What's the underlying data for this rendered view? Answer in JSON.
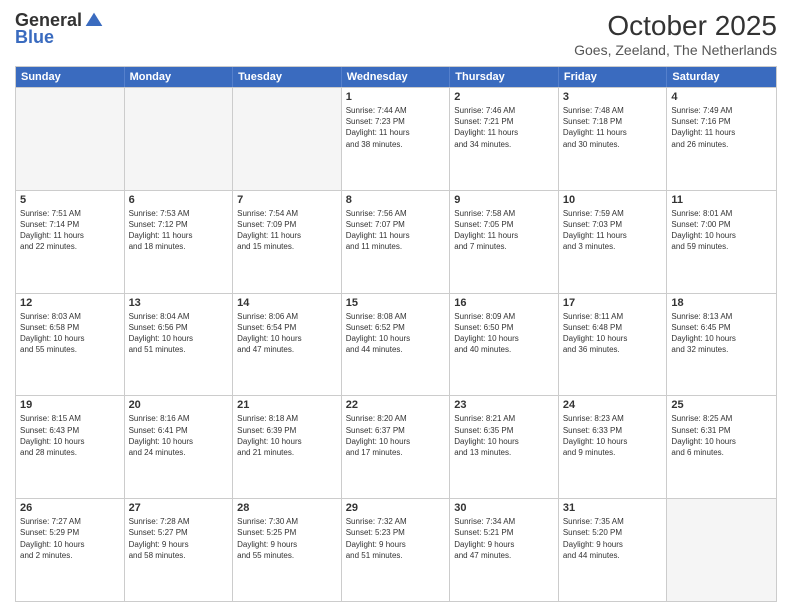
{
  "logo": {
    "general": "General",
    "blue": "Blue"
  },
  "header": {
    "month": "October 2025",
    "location": "Goes, Zeeland, The Netherlands"
  },
  "weekdays": [
    "Sunday",
    "Monday",
    "Tuesday",
    "Wednesday",
    "Thursday",
    "Friday",
    "Saturday"
  ],
  "rows": [
    [
      {
        "day": "",
        "lines": []
      },
      {
        "day": "",
        "lines": []
      },
      {
        "day": "",
        "lines": []
      },
      {
        "day": "1",
        "lines": [
          "Sunrise: 7:44 AM",
          "Sunset: 7:23 PM",
          "Daylight: 11 hours",
          "and 38 minutes."
        ]
      },
      {
        "day": "2",
        "lines": [
          "Sunrise: 7:46 AM",
          "Sunset: 7:21 PM",
          "Daylight: 11 hours",
          "and 34 minutes."
        ]
      },
      {
        "day": "3",
        "lines": [
          "Sunrise: 7:48 AM",
          "Sunset: 7:18 PM",
          "Daylight: 11 hours",
          "and 30 minutes."
        ]
      },
      {
        "day": "4",
        "lines": [
          "Sunrise: 7:49 AM",
          "Sunset: 7:16 PM",
          "Daylight: 11 hours",
          "and 26 minutes."
        ]
      }
    ],
    [
      {
        "day": "5",
        "lines": [
          "Sunrise: 7:51 AM",
          "Sunset: 7:14 PM",
          "Daylight: 11 hours",
          "and 22 minutes."
        ]
      },
      {
        "day": "6",
        "lines": [
          "Sunrise: 7:53 AM",
          "Sunset: 7:12 PM",
          "Daylight: 11 hours",
          "and 18 minutes."
        ]
      },
      {
        "day": "7",
        "lines": [
          "Sunrise: 7:54 AM",
          "Sunset: 7:09 PM",
          "Daylight: 11 hours",
          "and 15 minutes."
        ]
      },
      {
        "day": "8",
        "lines": [
          "Sunrise: 7:56 AM",
          "Sunset: 7:07 PM",
          "Daylight: 11 hours",
          "and 11 minutes."
        ]
      },
      {
        "day": "9",
        "lines": [
          "Sunrise: 7:58 AM",
          "Sunset: 7:05 PM",
          "Daylight: 11 hours",
          "and 7 minutes."
        ]
      },
      {
        "day": "10",
        "lines": [
          "Sunrise: 7:59 AM",
          "Sunset: 7:03 PM",
          "Daylight: 11 hours",
          "and 3 minutes."
        ]
      },
      {
        "day": "11",
        "lines": [
          "Sunrise: 8:01 AM",
          "Sunset: 7:00 PM",
          "Daylight: 10 hours",
          "and 59 minutes."
        ]
      }
    ],
    [
      {
        "day": "12",
        "lines": [
          "Sunrise: 8:03 AM",
          "Sunset: 6:58 PM",
          "Daylight: 10 hours",
          "and 55 minutes."
        ]
      },
      {
        "day": "13",
        "lines": [
          "Sunrise: 8:04 AM",
          "Sunset: 6:56 PM",
          "Daylight: 10 hours",
          "and 51 minutes."
        ]
      },
      {
        "day": "14",
        "lines": [
          "Sunrise: 8:06 AM",
          "Sunset: 6:54 PM",
          "Daylight: 10 hours",
          "and 47 minutes."
        ]
      },
      {
        "day": "15",
        "lines": [
          "Sunrise: 8:08 AM",
          "Sunset: 6:52 PM",
          "Daylight: 10 hours",
          "and 44 minutes."
        ]
      },
      {
        "day": "16",
        "lines": [
          "Sunrise: 8:09 AM",
          "Sunset: 6:50 PM",
          "Daylight: 10 hours",
          "and 40 minutes."
        ]
      },
      {
        "day": "17",
        "lines": [
          "Sunrise: 8:11 AM",
          "Sunset: 6:48 PM",
          "Daylight: 10 hours",
          "and 36 minutes."
        ]
      },
      {
        "day": "18",
        "lines": [
          "Sunrise: 8:13 AM",
          "Sunset: 6:45 PM",
          "Daylight: 10 hours",
          "and 32 minutes."
        ]
      }
    ],
    [
      {
        "day": "19",
        "lines": [
          "Sunrise: 8:15 AM",
          "Sunset: 6:43 PM",
          "Daylight: 10 hours",
          "and 28 minutes."
        ]
      },
      {
        "day": "20",
        "lines": [
          "Sunrise: 8:16 AM",
          "Sunset: 6:41 PM",
          "Daylight: 10 hours",
          "and 24 minutes."
        ]
      },
      {
        "day": "21",
        "lines": [
          "Sunrise: 8:18 AM",
          "Sunset: 6:39 PM",
          "Daylight: 10 hours",
          "and 21 minutes."
        ]
      },
      {
        "day": "22",
        "lines": [
          "Sunrise: 8:20 AM",
          "Sunset: 6:37 PM",
          "Daylight: 10 hours",
          "and 17 minutes."
        ]
      },
      {
        "day": "23",
        "lines": [
          "Sunrise: 8:21 AM",
          "Sunset: 6:35 PM",
          "Daylight: 10 hours",
          "and 13 minutes."
        ]
      },
      {
        "day": "24",
        "lines": [
          "Sunrise: 8:23 AM",
          "Sunset: 6:33 PM",
          "Daylight: 10 hours",
          "and 9 minutes."
        ]
      },
      {
        "day": "25",
        "lines": [
          "Sunrise: 8:25 AM",
          "Sunset: 6:31 PM",
          "Daylight: 10 hours",
          "and 6 minutes."
        ]
      }
    ],
    [
      {
        "day": "26",
        "lines": [
          "Sunrise: 7:27 AM",
          "Sunset: 5:29 PM",
          "Daylight: 10 hours",
          "and 2 minutes."
        ]
      },
      {
        "day": "27",
        "lines": [
          "Sunrise: 7:28 AM",
          "Sunset: 5:27 PM",
          "Daylight: 9 hours",
          "and 58 minutes."
        ]
      },
      {
        "day": "28",
        "lines": [
          "Sunrise: 7:30 AM",
          "Sunset: 5:25 PM",
          "Daylight: 9 hours",
          "and 55 minutes."
        ]
      },
      {
        "day": "29",
        "lines": [
          "Sunrise: 7:32 AM",
          "Sunset: 5:23 PM",
          "Daylight: 9 hours",
          "and 51 minutes."
        ]
      },
      {
        "day": "30",
        "lines": [
          "Sunrise: 7:34 AM",
          "Sunset: 5:21 PM",
          "Daylight: 9 hours",
          "and 47 minutes."
        ]
      },
      {
        "day": "31",
        "lines": [
          "Sunrise: 7:35 AM",
          "Sunset: 5:20 PM",
          "Daylight: 9 hours",
          "and 44 minutes."
        ]
      },
      {
        "day": "",
        "lines": []
      }
    ]
  ]
}
